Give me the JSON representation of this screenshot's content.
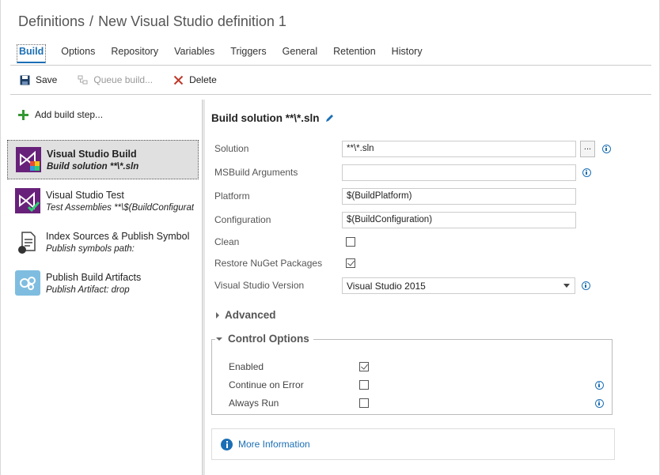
{
  "header": {
    "breadcrumb_root": "Definitions",
    "separator": "/",
    "definition_name": "New Visual Studio definition 1"
  },
  "tabs": [
    {
      "label": "Build",
      "active": true
    },
    {
      "label": "Options"
    },
    {
      "label": "Repository"
    },
    {
      "label": "Variables"
    },
    {
      "label": "Triggers"
    },
    {
      "label": "General"
    },
    {
      "label": "Retention"
    },
    {
      "label": "History"
    }
  ],
  "toolbar": {
    "save_label": "Save",
    "queue_label": "Queue build...",
    "delete_label": "Delete"
  },
  "steps_panel": {
    "add_step_label": "Add build step...",
    "steps": [
      {
        "name": "Visual Studio Build",
        "description": "Build solution **\\*.sln",
        "icon": "visual-studio-build-icon",
        "selected": true
      },
      {
        "name": "Visual Studio Test",
        "description": "Test Assemblies **\\$(BuildConfigurat",
        "icon": "visual-studio-test-icon"
      },
      {
        "name": "Index Sources & Publish Symbol",
        "description": "Publish symbols path:",
        "icon": "index-sources-icon"
      },
      {
        "name": "Publish Build Artifacts",
        "description": "Publish Artifact: drop",
        "icon": "publish-artifacts-icon"
      }
    ]
  },
  "detail": {
    "title": "Build solution **\\*.sln",
    "fields": {
      "solution": {
        "label": "Solution",
        "value": "**\\*.sln",
        "browse": "..."
      },
      "msbuild_args": {
        "label": "MSBuild Arguments",
        "value": ""
      },
      "platform": {
        "label": "Platform",
        "value": "$(BuildPlatform)"
      },
      "configuration": {
        "label": "Configuration",
        "value": "$(BuildConfiguration)"
      },
      "clean": {
        "label": "Clean",
        "checked": false
      },
      "restore_nuget": {
        "label": "Restore NuGet Packages",
        "checked": true
      },
      "vs_version": {
        "label": "Visual Studio Version",
        "value": "Visual Studio 2015"
      }
    },
    "advanced_label": "Advanced",
    "control_options": {
      "title": "Control Options",
      "enabled": {
        "label": "Enabled",
        "checked": true
      },
      "continue_on_error": {
        "label": "Continue on Error",
        "checked": false
      },
      "always_run": {
        "label": "Always Run",
        "checked": false
      }
    },
    "more_info_label": "More Information"
  },
  "colors": {
    "accent": "#1b6fb5",
    "add_green": "#339933",
    "delete_red": "#c0392b",
    "vs_purple": "#68217a"
  }
}
